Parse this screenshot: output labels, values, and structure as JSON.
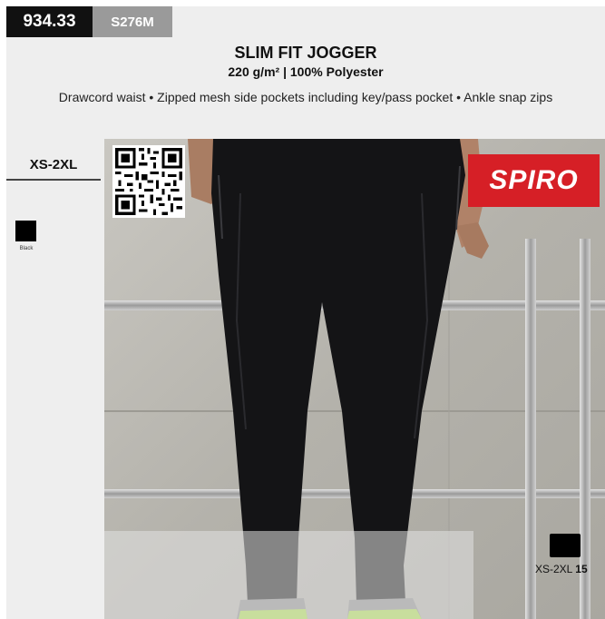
{
  "product": {
    "code": "934.33",
    "sku": "S276M",
    "title": "SLIM FIT JOGGER",
    "subtitle": "220 g/m² | 100% Polyester",
    "description": "Drawcord waist • Zipped mesh side pockets including key/pass pocket • Ankle snap zips"
  },
  "sizes": {
    "range": "XS-2XL"
  },
  "colors": [
    {
      "label": "Black",
      "hex": "#000000"
    }
  ],
  "brand": {
    "logo_text": "SPIRO",
    "accent": "#d61f26"
  },
  "carton": {
    "sizes": "XS-2XL",
    "quantity": "15"
  }
}
